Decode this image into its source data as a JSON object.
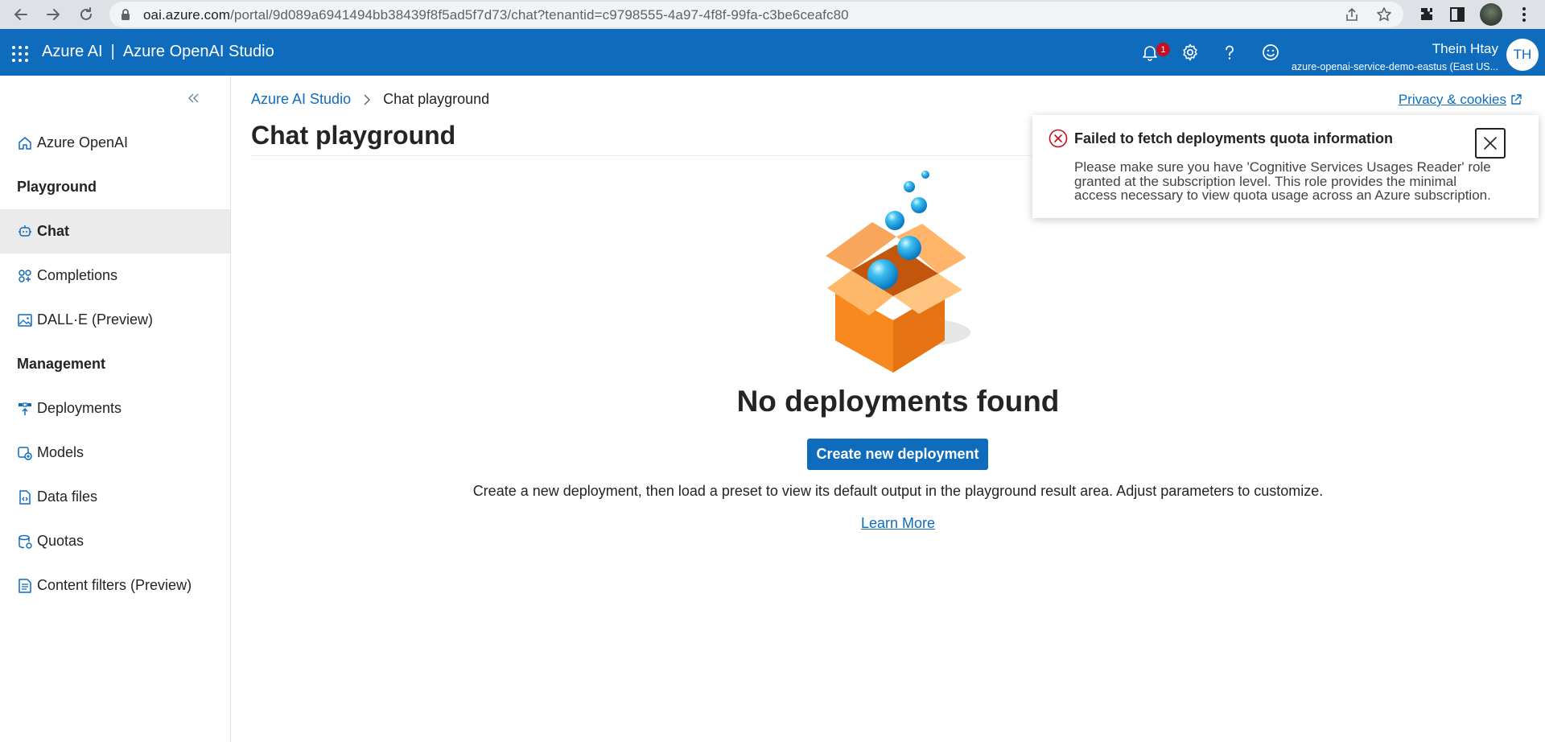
{
  "browser": {
    "url_host": "oai.azure.com",
    "url_path": "/portal/9d089a6941494bb38439f8f5ad5f7d73/chat?tenantid=c9798555-4a97-4f8f-99fa-c3be6ceafc80"
  },
  "header": {
    "brand": "Azure AI",
    "separator": "|",
    "product": "Azure OpenAI Studio",
    "notification_count": "1",
    "user_name": "Thein Htay",
    "user_resource": "azure-openai-service-demo-eastus (East US...",
    "avatar_initials": "TH",
    "accent_color": "#0f6cbd"
  },
  "sidebar": {
    "items": [
      {
        "label": "Azure OpenAI",
        "icon": "home-icon"
      },
      {
        "label": "Chat",
        "icon": "chat-icon",
        "active": true
      },
      {
        "label": "Completions",
        "icon": "completions-icon"
      },
      {
        "label": "DALL·E (Preview)",
        "icon": "image-icon"
      },
      {
        "label": "Deployments",
        "icon": "deployments-icon"
      },
      {
        "label": "Models",
        "icon": "models-icon"
      },
      {
        "label": "Data files",
        "icon": "data-files-icon"
      },
      {
        "label": "Quotas",
        "icon": "quotas-icon"
      },
      {
        "label": "Content filters (Preview)",
        "icon": "content-filters-icon"
      }
    ],
    "sections": {
      "playground": "Playground",
      "management": "Management"
    }
  },
  "main": {
    "breadcrumb_root": "Azure AI Studio",
    "breadcrumb_current": "Chat playground",
    "title": "Chat playground",
    "privacy_link": "Privacy & cookies",
    "empty_title": "No deployments found",
    "create_button": "Create new deployment",
    "empty_description": "Create a new deployment, then load a preset to view its default output in the playground result area. Adjust parameters to customize.",
    "learn_more": "Learn More"
  },
  "toast": {
    "title": "Failed to fetch deployments quota information",
    "body": "Please make sure you have 'Cognitive Services Usages Reader' role granted at the subscription level. This role provides the minimal access necessary to view quota usage across an Azure subscription.",
    "error_color": "#c50f1f"
  }
}
